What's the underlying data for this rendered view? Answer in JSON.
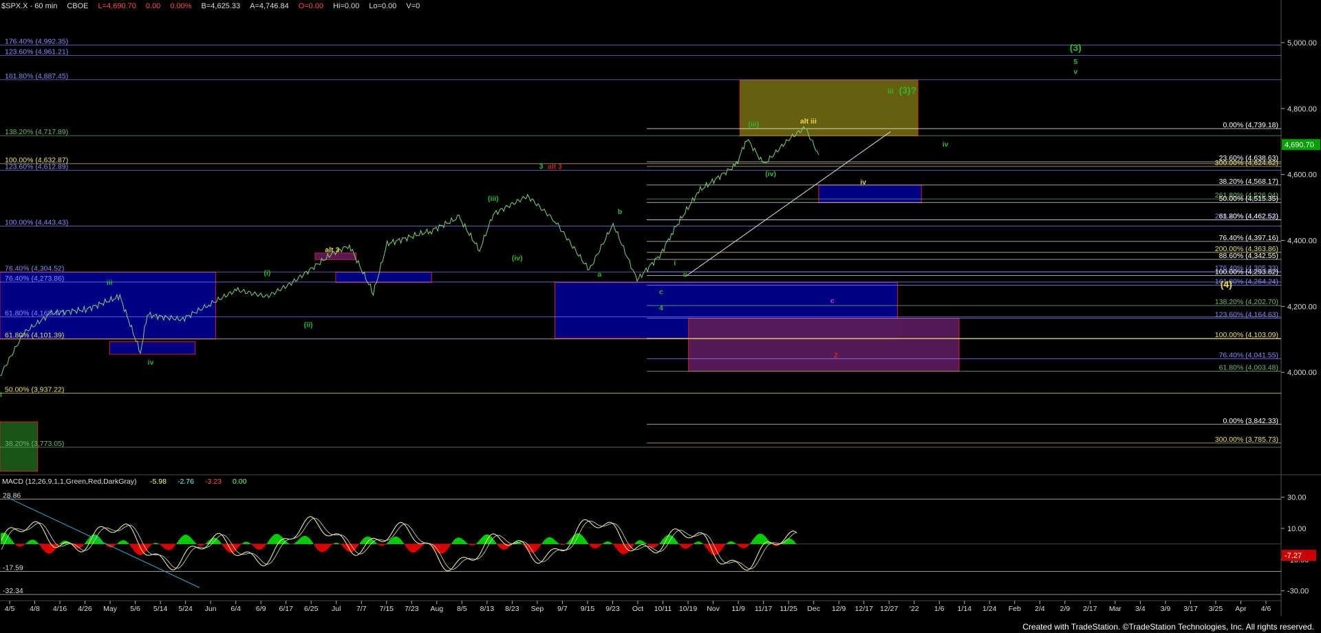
{
  "header": {
    "symbol": "$SPX.X - 60 min",
    "exchange": "CBOE",
    "last": "L=4,690.70",
    "change": "0.00",
    "change_pct": "0.00%",
    "bid": "B=4,625.33",
    "ask": "A=4,746.84",
    "open": "O=0.00",
    "hi": "Hi=0.00",
    "lo": "Lo=0.00",
    "vol": "V=0"
  },
  "credit": "Created with TradeStation. ©TradeStation Technologies, Inc. All rights reserved.",
  "colors": {
    "background": "#000000",
    "price": "#7fd07f",
    "fib_white": "#ffffff",
    "fib_yellow": "#e8e070",
    "fib_blue": "#8a8aff",
    "fib_green": "#70b870",
    "box_blue": "#00008b",
    "box_olive": "#6b6410",
    "box_purple": "#5a1a5a",
    "macd_up": "#00cc00",
    "macd_down": "#dd0000",
    "wave_green": "#2eb82e",
    "wave_yellow": "#e8d84a",
    "wave_red": "#cc2222",
    "wave_magenta": "#bb44bb",
    "last_label_bg": "#00a000"
  },
  "chart_data": {
    "type": "line",
    "title": "$SPX.X - 60 min",
    "ylim": [
      3700,
      5100
    ],
    "x_ticks": [
      "4/5",
      "4/8",
      "4/16",
      "4/26",
      "May",
      "5/6",
      "5/14",
      "5/24",
      "Jun",
      "6/4",
      "6/9",
      "6/17",
      "6/25",
      "Jul",
      "7/7",
      "7/15",
      "7/23",
      "Aug",
      "8/5",
      "8/13",
      "8/23",
      "Sep",
      "9/7",
      "9/15",
      "9/23",
      "Oct",
      "10/11",
      "10/19",
      "Nov",
      "11/9",
      "11/17",
      "11/25",
      "Dec",
      "12/9",
      "12/17",
      "12/27",
      "'22",
      "1/6",
      "1/14",
      "1/24",
      "Feb",
      "2/4",
      "2/9",
      "2/17",
      "Mar",
      "3/4",
      "3/9",
      "3/17",
      "3/25",
      "Apr",
      "4/6"
    ],
    "y_ticks": [
      "5,000.00",
      "4,800.00",
      "4,600.00",
      "4,400.00",
      "4,200.00",
      "4,000.00"
    ],
    "last_price_label": "4,690.70",
    "price_series": {
      "x_dates": [
        "2021-04-01",
        "2021-04-08",
        "2021-04-16",
        "2021-04-26",
        "2021-05-06",
        "2021-05-12",
        "2021-05-14",
        "2021-05-24",
        "2021-06-01",
        "2021-06-09",
        "2021-06-18",
        "2021-06-25",
        "2021-07-07",
        "2021-07-12",
        "2021-07-19",
        "2021-07-23",
        "2021-08-05",
        "2021-08-13",
        "2021-08-19",
        "2021-08-23",
        "2021-09-02",
        "2021-09-10",
        "2021-09-20",
        "2021-09-27",
        "2021-10-04",
        "2021-10-11",
        "2021-10-14",
        "2021-10-22",
        "2021-11-02",
        "2021-11-05",
        "2021-11-10",
        "2021-11-17",
        "2021-11-22",
        "2021-11-26"
      ],
      "values": [
        3990,
        4120,
        4180,
        4190,
        4230,
        4060,
        4175,
        4160,
        4205,
        4250,
        4230,
        4270,
        4360,
        4385,
        4240,
        4390,
        4430,
        4470,
        4370,
        4480,
        4535,
        4460,
        4310,
        4450,
        4280,
        4360,
        4420,
        4550,
        4630,
        4710,
        4630,
        4705,
        4743,
        4660
      ]
    },
    "fib_levels_left": [
      {
        "label": "176.40% (4,992.35)",
        "value": 4992.35,
        "color": "#8a8aff"
      },
      {
        "label": "123.60% (4,961.21)",
        "value": 4961.21,
        "color": "#8a8aff"
      },
      {
        "label": "161.80% (4,887.45)",
        "value": 4887.45,
        "color": "#8a8aff"
      },
      {
        "label": "138.20% (4,717.89)",
        "value": 4717.89,
        "color": "#70b870"
      },
      {
        "label": "100.00% (4,632.87)",
        "value": 4632.87,
        "color": "#e8e070"
      },
      {
        "label": "123.60% (4,612.89)",
        "value": 4612.89,
        "color": "#8a8aff"
      },
      {
        "label": "100.00% (4,443.43)",
        "value": 4443.43,
        "color": "#8a8aff"
      },
      {
        "label": "76.40% (4,304.52)",
        "value": 4304.52,
        "color": "#8a8aff"
      },
      {
        "label": "76.40% (4,273.86)",
        "value": 4273.86,
        "color": "#8a8aff"
      },
      {
        "label": "61.80% (4,168.47)",
        "value": 4168.47,
        "color": "#8a8aff"
      },
      {
        "label": "61.80% (4,101.39)",
        "value": 4101.39,
        "color": "#e8e070"
      },
      {
        "label": "50.00% (3,937.22)",
        "value": 3937.22,
        "color": "#e8e070"
      },
      {
        "label": "38.20% (3,773.05)",
        "value": 3773.05,
        "color": "#70b870"
      }
    ],
    "fib_levels_right": [
      {
        "label": "0.00% (4,739.18)",
        "value": 4739.18,
        "color": "#ffffff"
      },
      {
        "label": "23.60% (4,638.63)",
        "value": 4638.63,
        "color": "#ffffff"
      },
      {
        "label": "300.00% (4,624.62)",
        "value": 4624.62,
        "color": "#e8e070"
      },
      {
        "label": "38.20% (4,568.17)",
        "value": 4568.17,
        "color": "#ffffff"
      },
      {
        "label": "261.80% (4,526.04)",
        "value": 4526.04,
        "color": "#70b870"
      },
      {
        "label": "50.00% (4,515.35)",
        "value": 4515.35,
        "color": "#ffffff"
      },
      {
        "label": "238.20% (4,462.63)",
        "value": 4462.63,
        "color": "#8a8aff"
      },
      {
        "label": "61.80% (4,462.52)",
        "value": 4462.52,
        "color": "#ffffff"
      },
      {
        "label": "76.40% (4,397.16)",
        "value": 4397.16,
        "color": "#ffffff"
      },
      {
        "label": "200.00% (4,363.86)",
        "value": 4363.86,
        "color": "#e8e070"
      },
      {
        "label": "88.60% (4,342.55)",
        "value": 4342.55,
        "color": "#ffffff"
      },
      {
        "label": "176.40% (4,305.33)",
        "value": 4305.33,
        "color": "#8a8aff"
      },
      {
        "label": "100.00% (4,293.82)",
        "value": 4293.82,
        "color": "#ffffff"
      },
      {
        "label": "161.80% (4,264.24)",
        "value": 4264.24,
        "color": "#8a8aff"
      },
      {
        "label": "138.20% (4,202.70)",
        "value": 4202.7,
        "color": "#70b870"
      },
      {
        "label": "123.60% (4,164.63)",
        "value": 4164.63,
        "color": "#8a8aff"
      },
      {
        "label": "100.00% (4,103.09)",
        "value": 4103.09,
        "color": "#e8e070"
      },
      {
        "label": "76.40% (4,041.55)",
        "value": 4041.55,
        "color": "#8a8aff"
      },
      {
        "label": "61.80% (4,003.48)",
        "value": 4003.48,
        "color": "#70b870"
      },
      {
        "label": "0.00% (3,842.33)",
        "value": 3842.33,
        "color": "#ffffff"
      },
      {
        "label": "300.00% (3,785.73)",
        "value": 3785.73,
        "color": "#e8e070"
      }
    ],
    "wave_labels": [
      {
        "text": "(3)",
        "color": "#2eb82e",
        "date": "2022-02-09",
        "value": 4975
      },
      {
        "text": "5",
        "color": "#2eb82e",
        "date": "2022-02-09",
        "value": 4935
      },
      {
        "text": "v",
        "color": "#2eb82e",
        "date": "2022-02-09",
        "value": 4905
      },
      {
        "text": "iii",
        "color": "#2eb82e",
        "date": "2021-12-17",
        "value": 4845
      },
      {
        "text": "(3)?",
        "color": "#2eb82e",
        "date": "2021-12-22",
        "value": 4845
      },
      {
        "text": "(iii)",
        "color": "#2eb82e",
        "date": "2021-11-07",
        "value": 4745
      },
      {
        "text": "alt iii",
        "color": "#e8d84a",
        "date": "2021-11-23",
        "value": 4755
      },
      {
        "text": "iv",
        "color": "#2eb82e",
        "date": "2022-01-02",
        "value": 4685
      },
      {
        "text": "(iv)",
        "color": "#2eb82e",
        "date": "2021-11-12",
        "value": 4595
      },
      {
        "text": "iv",
        "color": "#e8d84a",
        "date": "2021-12-09",
        "value": 4570
      },
      {
        "text": "3",
        "color": "#2eb82e",
        "date": "2021-09-06",
        "value": 4618
      },
      {
        "text": "alt 3",
        "color": "#cc2222",
        "date": "2021-09-10",
        "value": 4617
      },
      {
        "text": "(iii)",
        "color": "#2eb82e",
        "date": "2021-08-23",
        "value": 4520
      },
      {
        "text": "b",
        "color": "#2eb82e",
        "date": "2021-09-29",
        "value": 4480
      },
      {
        "text": "alt 3",
        "color": "#e8d84a",
        "date": "2021-07-07",
        "value": 4365
      },
      {
        "text": "(iv)",
        "color": "#2eb82e",
        "date": "2021-08-30",
        "value": 4340
      },
      {
        "text": "(i)",
        "color": "#2eb82e",
        "date": "2021-06-18",
        "value": 4295
      },
      {
        "text": "iii",
        "color": "#2eb82e",
        "date": "2021-05-03",
        "value": 4265
      },
      {
        "text": "a",
        "color": "#2eb82e",
        "date": "2021-09-23",
        "value": 4290
      },
      {
        "text": "i",
        "color": "#2eb82e",
        "date": "2021-10-15",
        "value": 4325
      },
      {
        "text": "ii",
        "color": "#2eb82e",
        "date": "2021-10-18",
        "value": 4290
      },
      {
        "text": "c",
        "color": "#2eb82e",
        "date": "2021-10-11",
        "value": 4237
      },
      {
        "text": "4",
        "color": "#2eb82e",
        "date": "2021-10-11",
        "value": 4188
      },
      {
        "text": "c",
        "color": "#bb44bb",
        "date": "2021-11-30",
        "value": 4210
      },
      {
        "text": "(4)",
        "color": "#e8d84a",
        "date": "2022-03-25",
        "value": 4257
      },
      {
        "text": "(ii)",
        "color": "#2eb82e",
        "date": "2021-06-30",
        "value": 4137
      },
      {
        "text": "iv",
        "color": "#2eb82e",
        "date": "2021-05-15",
        "value": 4023
      },
      {
        "text": "2",
        "color": "#cc2222",
        "date": "2021-12-01",
        "value": 4045
      },
      {
        "text": "ii",
        "color": "#2eb82e",
        "date": "2021-04-01",
        "value": 3925
      }
    ],
    "boxes": [
      {
        "name": "target-box-olive",
        "color": "#6b6410",
        "border": "#cc2222",
        "date_from": "2021-11-03",
        "date_to": "2021-12-25",
        "low": 4717,
        "high": 4887
      },
      {
        "name": "support-box-blue-small",
        "color": "#00008b",
        "border": "#cc2222",
        "date_from": "2021-11-26",
        "date_to": "2021-12-26",
        "low": 4515,
        "high": 4568
      },
      {
        "name": "support-box-blue-large",
        "color": "#00008b",
        "border": "#cc2222",
        "date_from": "2021-09-10",
        "date_to": "2021-12-19",
        "low": 4103,
        "high": 4273
      },
      {
        "name": "support-box-purple",
        "color": "#5a1a5a",
        "border": "#cc2222",
        "date_from": "2021-10-19",
        "date_to": "2022-01-06",
        "low": 4003,
        "high": 4164
      },
      {
        "name": "support-box-blue-left",
        "color": "#00008b",
        "border": "#cc2222",
        "date_from": "2021-04-01",
        "date_to": "2021-06-03",
        "low": 4101,
        "high": 4304
      },
      {
        "name": "box-blue-left-small",
        "color": "#00008b",
        "border": "#cc2222",
        "date_from": "2021-05-03",
        "date_to": "2021-05-28",
        "low": 4055,
        "high": 4093
      },
      {
        "name": "box-blue-jul",
        "color": "#00008b",
        "border": "#cc2222",
        "date_from": "2021-07-08",
        "date_to": "2021-08-05",
        "low": 4273,
        "high": 4304
      },
      {
        "name": "box-purple-jul",
        "color": "#5a1a5a",
        "border": "#cc2222",
        "date_from": "2021-07-02",
        "date_to": "2021-07-14",
        "low": 4342,
        "high": 4362
      },
      {
        "name": "box-green-bottom",
        "color": "#1a5a1a",
        "border": "#cc2222",
        "date_from": "2021-04-01",
        "date_to": "2021-04-12",
        "low": 3700,
        "high": 3850
      }
    ],
    "trendline": {
      "from_date": "2021-10-18",
      "from_value": 4290,
      "to_date": "2021-12-17",
      "to_value": 4730
    },
    "macd": {
      "title": "MACD (12,26,9,1,1,Green,Red,DarkGray)",
      "values": [
        "-5.98",
        "-2.76",
        "-3.23",
        "0.00"
      ],
      "ylim": [
        -35,
        40
      ],
      "y_ticks": [
        "30.00",
        "10.00",
        "-10.00",
        "-30.00"
      ],
      "left_labels": [
        {
          "label": "28.86",
          "value": 28.86
        },
        {
          "label": "-17.59",
          "value": -17.59
        },
        {
          "label": "-32.34",
          "value": -32.34
        }
      ],
      "last_value_label": "-7.27"
    }
  }
}
